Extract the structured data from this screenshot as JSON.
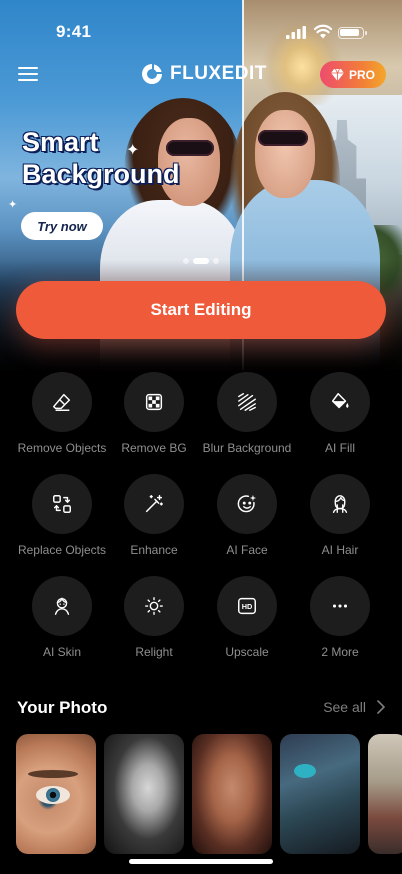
{
  "status_bar": {
    "time": "9:41"
  },
  "header": {
    "brand": "FLUXEDIT",
    "pro_label": "PRO"
  },
  "banner": {
    "title_line1": "Smart",
    "title_line2": "Background",
    "cta": "Try now",
    "slide_count": 3,
    "active_slide": 2
  },
  "primary_action": {
    "label": "Start Editing"
  },
  "tools": [
    {
      "label": "Remove Objects",
      "icon": "eraser-icon"
    },
    {
      "label": "Remove BG",
      "icon": "checker-icon"
    },
    {
      "label": "Blur Background",
      "icon": "blur-icon"
    },
    {
      "label": "AI Fill",
      "icon": "paint-bucket-icon"
    },
    {
      "label": "Replace Objects",
      "icon": "replace-icon"
    },
    {
      "label": "Enhance",
      "icon": "magic-wand-icon"
    },
    {
      "label": "AI Face",
      "icon": "smiley-sparkle-icon"
    },
    {
      "label": "AI Hair",
      "icon": "hair-icon"
    },
    {
      "label": "AI Skin",
      "icon": "skin-icon"
    },
    {
      "label": "Relight",
      "icon": "sun-icon"
    },
    {
      "label": "Upscale",
      "icon": "hd-icon"
    },
    {
      "label": "2 More",
      "icon": "more-dots-icon"
    }
  ],
  "photos": {
    "title": "Your Photo",
    "see_all": "See all"
  },
  "colors": {
    "accent": "#ee5a3a",
    "pro_gradient_start": "#ee4c6f",
    "pro_gradient_end": "#f3a72a",
    "tool_circle": "#1d1d1d",
    "label_gray": "#8f8f8f"
  }
}
